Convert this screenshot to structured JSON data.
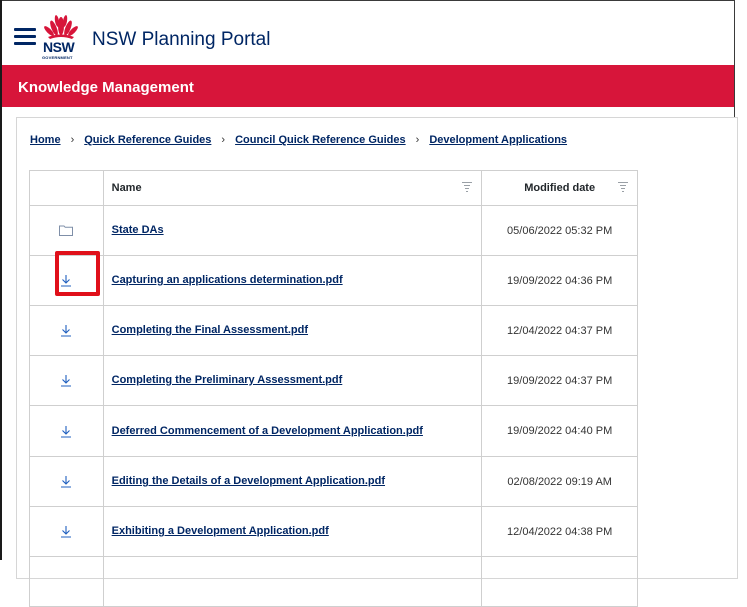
{
  "header": {
    "logo_text": "NSW",
    "logo_subtext": "GOVERNMENT",
    "portal_title": "NSW Planning Portal"
  },
  "banner": {
    "title": "Knowledge Management"
  },
  "breadcrumb": [
    "Home",
    "Quick Reference Guides",
    "Council Quick Reference Guides",
    "Development Applications"
  ],
  "table": {
    "columns": {
      "name": "Name",
      "modified": "Modified date"
    },
    "rows": [
      {
        "type": "folder-icon",
        "name": "State DAs",
        "modified": "05/06/2022 05:32 PM"
      },
      {
        "type": "download-icon",
        "name": "Capturing an applications determination.pdf",
        "modified": "19/09/2022 04:36 PM"
      },
      {
        "type": "download-icon",
        "name": "Completing the Final Assessment.pdf",
        "modified": "12/04/2022 04:37 PM"
      },
      {
        "type": "download-icon",
        "name": "Completing the Preliminary Assessment.pdf",
        "modified": "19/09/2022 04:37 PM"
      },
      {
        "type": "download-icon",
        "name": "Deferred Commencement of a Development Application.pdf",
        "modified": "19/09/2022 04:40 PM"
      },
      {
        "type": "download-icon",
        "name": "Editing the Details of a Development Application.pdf",
        "modified": "02/08/2022 09:19 AM"
      },
      {
        "type": "download-icon",
        "name": "Exhibiting a Development Application.pdf",
        "modified": "12/04/2022 04:38 PM"
      }
    ]
  },
  "colors": {
    "brand_navy": "#002664",
    "banner_red": "#d7153a",
    "highlight_red": "#e0101a"
  }
}
